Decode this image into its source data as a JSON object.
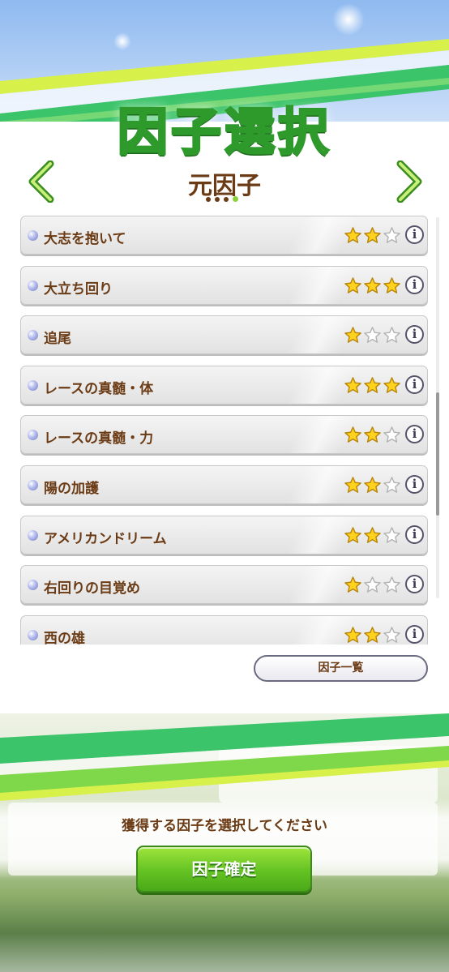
{
  "screen": {
    "title": "因子選択",
    "section_title": "元因子",
    "page_indicator": {
      "total": 4,
      "active": 4
    }
  },
  "factors": [
    {
      "name": "大志を抱いて",
      "stars": 2,
      "max_stars": 3
    },
    {
      "name": "大立ち回り",
      "stars": 3,
      "max_stars": 3
    },
    {
      "name": "追尾",
      "stars": 1,
      "max_stars": 3
    },
    {
      "name": "レースの真髄・体",
      "stars": 3,
      "max_stars": 3
    },
    {
      "name": "レースの真髄・力",
      "stars": 2,
      "max_stars": 3
    },
    {
      "name": "陽の加護",
      "stars": 2,
      "max_stars": 3
    },
    {
      "name": "アメリカンドリーム",
      "stars": 2,
      "max_stars": 3
    },
    {
      "name": "右回りの目覚め",
      "stars": 1,
      "max_stars": 3
    },
    {
      "name": "西の雄",
      "stars": 2,
      "max_stars": 3
    }
  ],
  "info_glyph": "i",
  "scroll_position": 0.68,
  "factor_list_button": "因子一覧",
  "prompt": "獲得する因子を選択してください",
  "confirm_button": "因子確定",
  "colors": {
    "brown_text": "#6b3b15",
    "accent_green": "#5fbe22",
    "star_filled": "#ffd21e",
    "star_empty": "#ffffff"
  }
}
